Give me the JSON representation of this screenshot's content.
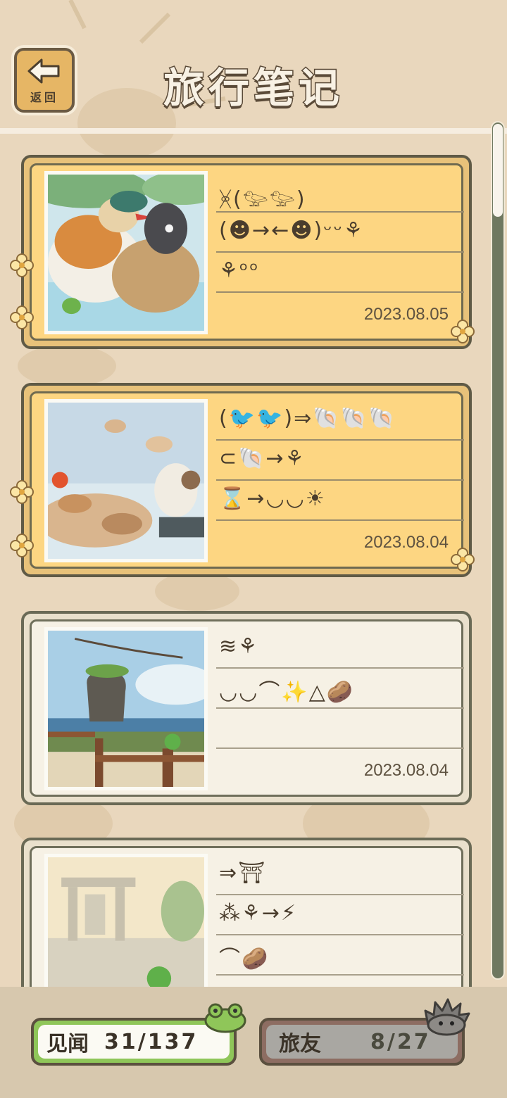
{
  "header": {
    "title": "旅行笔记",
    "back_label": "返回"
  },
  "entries": [
    {
      "glyphs": [
        "ᚸ(𓅰𓅰)",
        "(☻→←☻)ᵕᵕ⚘",
        "⚘ᵒᵒ"
      ],
      "date": "2023.08.05",
      "highlighted": true,
      "photo": "mandarin-ducks"
    },
    {
      "glyphs": [
        "(🐦🐦)⇒🐚🐚🐚",
        "⊂🐚→⚘",
        "⌛→◡◡☀"
      ],
      "date": "2023.08.04",
      "highlighted": true,
      "photo": "clams-and-bird"
    },
    {
      "glyphs": [
        "≋⚘",
        "◡◡⌒✨△🥔",
        ""
      ],
      "date": "2023.08.04",
      "highlighted": false,
      "photo": "sea-stack-fence"
    },
    {
      "glyphs": [
        "⇒⛩",
        "⁂⚘→⚡",
        "⌒🥔"
      ],
      "date": "",
      "highlighted": false,
      "photo": "memorial-gate"
    }
  ],
  "stats": {
    "jianwen_label": "见闻",
    "jianwen_value": "31/137",
    "lvyou_label": "旅友",
    "lvyou_value": "8/27"
  },
  "colors": {
    "background": "#e9d7bd",
    "highlight_card": "#fdd682",
    "plain_card": "#f6f1e5",
    "green_badge": "#8fc659",
    "brown_badge": "#8d6d62"
  }
}
